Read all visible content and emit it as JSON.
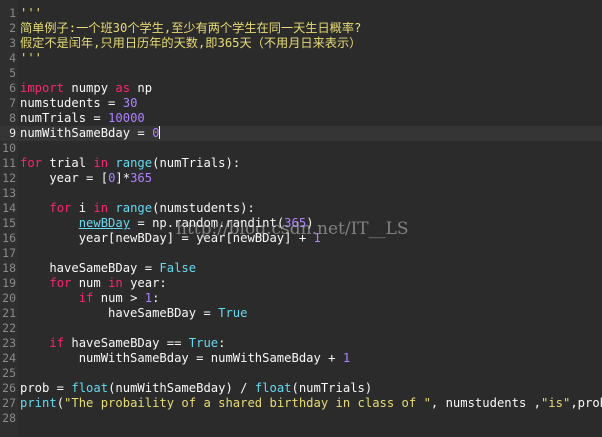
{
  "editor": {
    "colors": {
      "background": "#2b2b2b",
      "plain": "#f8f8f8",
      "keyword": "#f92672",
      "builtin": "#66d9ef",
      "number": "#ae81ff",
      "string": "#e6db74",
      "line_number": "#8a8a8a"
    },
    "current_line": 9,
    "lines": [
      {
        "n": "1",
        "tokens": [
          {
            "t": "'''",
            "c": "string"
          }
        ]
      },
      {
        "n": "2",
        "tokens": [
          {
            "t": "简单例子:一个班30个学生,至少有两个学生在同一天生日概率?",
            "c": "string"
          }
        ]
      },
      {
        "n": "3",
        "tokens": [
          {
            "t": "假定不是闰年,只用日历年的天数,即365天（不用月日来表示）",
            "c": "string"
          }
        ]
      },
      {
        "n": "4",
        "tokens": [
          {
            "t": "'''",
            "c": "string"
          }
        ]
      },
      {
        "n": "5",
        "tokens": []
      },
      {
        "n": "6",
        "tokens": [
          {
            "t": "import",
            "c": "keyword"
          },
          {
            "t": " numpy ",
            "c": "plain"
          },
          {
            "t": "as",
            "c": "keyword"
          },
          {
            "t": " np",
            "c": "plain"
          }
        ]
      },
      {
        "n": "7",
        "tokens": [
          {
            "t": "numstudents = ",
            "c": "plain"
          },
          {
            "t": "30",
            "c": "number"
          }
        ]
      },
      {
        "n": "8",
        "tokens": [
          {
            "t": "numTrials = ",
            "c": "plain"
          },
          {
            "t": "10000",
            "c": "number"
          }
        ]
      },
      {
        "n": "9",
        "tokens": [
          {
            "t": "numWithSameBday = ",
            "c": "plain"
          },
          {
            "t": "0",
            "c": "number"
          }
        ]
      },
      {
        "n": "10",
        "tokens": []
      },
      {
        "n": "11",
        "tokens": [
          {
            "t": "for",
            "c": "keyword"
          },
          {
            "t": " trial ",
            "c": "plain"
          },
          {
            "t": "in",
            "c": "keyword"
          },
          {
            "t": " ",
            "c": "plain"
          },
          {
            "t": "range",
            "c": "builtin"
          },
          {
            "t": "(numTrials):",
            "c": "plain"
          }
        ]
      },
      {
        "n": "12",
        "tokens": [
          {
            "t": "    year = [",
            "c": "plain"
          },
          {
            "t": "0",
            "c": "number"
          },
          {
            "t": "]*",
            "c": "plain"
          },
          {
            "t": "365",
            "c": "number"
          }
        ]
      },
      {
        "n": "13",
        "tokens": []
      },
      {
        "n": "14",
        "tokens": [
          {
            "t": "    ",
            "c": "plain"
          },
          {
            "t": "for",
            "c": "keyword"
          },
          {
            "t": " i ",
            "c": "plain"
          },
          {
            "t": "in",
            "c": "keyword"
          },
          {
            "t": " ",
            "c": "plain"
          },
          {
            "t": "range",
            "c": "builtin"
          },
          {
            "t": "(numstudents):",
            "c": "plain"
          }
        ]
      },
      {
        "n": "15",
        "tokens": [
          {
            "t": "        ",
            "c": "plain"
          },
          {
            "t": "newBDay",
            "c": "link"
          },
          {
            "t": " = np.random.randint(",
            "c": "plain"
          },
          {
            "t": "365",
            "c": "number"
          },
          {
            "t": ")",
            "c": "plain"
          }
        ]
      },
      {
        "n": "16",
        "tokens": [
          {
            "t": "        year[newBDay] = year[newBDay] + ",
            "c": "plain"
          },
          {
            "t": "1",
            "c": "number"
          }
        ]
      },
      {
        "n": "17",
        "tokens": []
      },
      {
        "n": "18",
        "tokens": [
          {
            "t": "    haveSameBDay = ",
            "c": "plain"
          },
          {
            "t": "False",
            "c": "builtin"
          }
        ]
      },
      {
        "n": "19",
        "tokens": [
          {
            "t": "    ",
            "c": "plain"
          },
          {
            "t": "for",
            "c": "keyword"
          },
          {
            "t": " num ",
            "c": "plain"
          },
          {
            "t": "in",
            "c": "keyword"
          },
          {
            "t": " year:",
            "c": "plain"
          }
        ]
      },
      {
        "n": "20",
        "tokens": [
          {
            "t": "        ",
            "c": "plain"
          },
          {
            "t": "if",
            "c": "keyword"
          },
          {
            "t": " num > ",
            "c": "plain"
          },
          {
            "t": "1",
            "c": "number"
          },
          {
            "t": ":",
            "c": "plain"
          }
        ]
      },
      {
        "n": "21",
        "tokens": [
          {
            "t": "            haveSameBDay = ",
            "c": "plain"
          },
          {
            "t": "True",
            "c": "builtin"
          }
        ]
      },
      {
        "n": "22",
        "tokens": []
      },
      {
        "n": "23",
        "tokens": [
          {
            "t": "    ",
            "c": "plain"
          },
          {
            "t": "if",
            "c": "keyword"
          },
          {
            "t": " haveSameBDay == ",
            "c": "plain"
          },
          {
            "t": "True",
            "c": "builtin"
          },
          {
            "t": ":",
            "c": "plain"
          }
        ]
      },
      {
        "n": "24",
        "tokens": [
          {
            "t": "        numWithSameBday = numWithSameBday + ",
            "c": "plain"
          },
          {
            "t": "1",
            "c": "number"
          }
        ]
      },
      {
        "n": "25",
        "tokens": []
      },
      {
        "n": "26",
        "tokens": [
          {
            "t": "prob = ",
            "c": "plain"
          },
          {
            "t": "float",
            "c": "builtin"
          },
          {
            "t": "(numWithSameBday) / ",
            "c": "plain"
          },
          {
            "t": "float",
            "c": "builtin"
          },
          {
            "t": "(numTrials)",
            "c": "plain"
          }
        ]
      },
      {
        "n": "27",
        "tokens": [
          {
            "t": "print",
            "c": "builtin"
          },
          {
            "t": "(",
            "c": "plain"
          },
          {
            "t": "\"The probaility of a shared birthday in class of \"",
            "c": "string"
          },
          {
            "t": ", numstudents ,",
            "c": "plain"
          },
          {
            "t": "\"is\"",
            "c": "string"
          },
          {
            "t": ",prob)",
            "c": "plain"
          }
        ]
      },
      {
        "n": "28",
        "tokens": []
      }
    ]
  },
  "watermark": "http://blog.csdn.net/IT__LS"
}
